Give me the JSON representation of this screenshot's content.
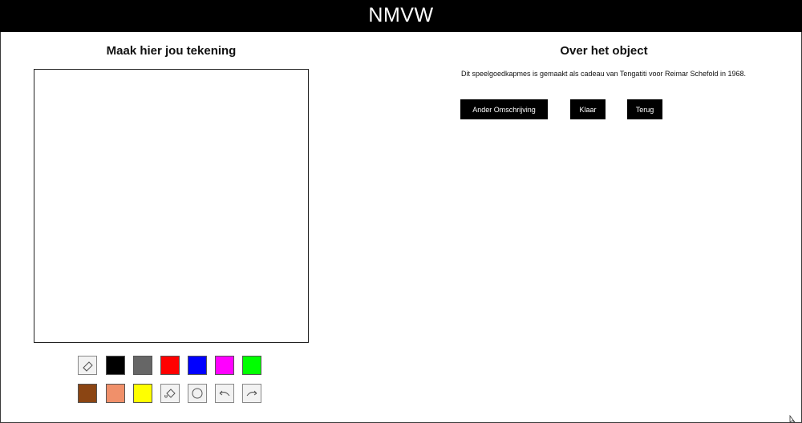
{
  "header": {
    "brand": "NMVW"
  },
  "left": {
    "title": "Maak hier jou tekening"
  },
  "palette": {
    "colors": [
      "#000000",
      "#666666",
      "#ff0000",
      "#0000ff",
      "#ff00ff",
      "#00ff00",
      "#8B4513",
      "#f0906a",
      "#ffff00"
    ],
    "tools": [
      "eraser-icon",
      "fill-icon",
      "circle-icon",
      "undo-icon",
      "redo-icon"
    ]
  },
  "right": {
    "title": "Over het object",
    "description": "Dit speelgoedkapmes is gemaakt als cadeau van Tengatiti voor Reimar Schefold in 1968.",
    "buttons": {
      "other": "Ander Omschrijving",
      "done": "Klaar",
      "back": "Terug"
    }
  }
}
